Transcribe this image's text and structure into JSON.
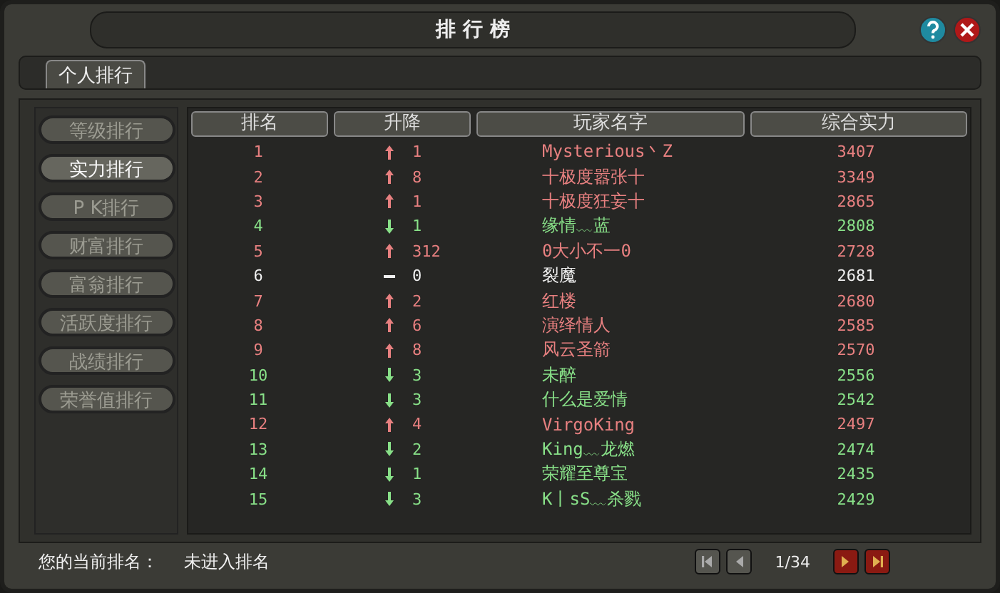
{
  "window": {
    "title": "排 行 榜"
  },
  "tabs": [
    {
      "label": "个人排行",
      "selected": true
    }
  ],
  "sidebar": {
    "items": [
      {
        "label": "等级排行",
        "selected": false
      },
      {
        "label": "实力排行",
        "selected": true
      },
      {
        "label": "P K排行",
        "selected": false
      },
      {
        "label": "财富排行",
        "selected": false
      },
      {
        "label": "富翁排行",
        "selected": false
      },
      {
        "label": "活跃度排行",
        "selected": false
      },
      {
        "label": "战绩排行",
        "selected": false
      },
      {
        "label": "荣誉值排行",
        "selected": false
      }
    ]
  },
  "table": {
    "columns": [
      "排名",
      "升降",
      "玩家名字",
      "综合实力"
    ],
    "rows": [
      {
        "rank": "1",
        "kind": "up",
        "change": "1",
        "name": "Mysterious丶Z",
        "power": "3407"
      },
      {
        "rank": "2",
        "kind": "up",
        "change": "8",
        "name": "十极度嚣张十",
        "power": "3349"
      },
      {
        "rank": "3",
        "kind": "up",
        "change": "1",
        "name": "十极度狂妄十",
        "power": "2865"
      },
      {
        "rank": "4",
        "kind": "down",
        "change": "1",
        "name": "缘情﹏蓝",
        "power": "2808"
      },
      {
        "rank": "5",
        "kind": "up",
        "change": "312",
        "name": "0大小不一0",
        "power": "2728"
      },
      {
        "rank": "6",
        "kind": "same",
        "change": "0",
        "name": "裂魔",
        "power": "2681"
      },
      {
        "rank": "7",
        "kind": "up",
        "change": "2",
        "name": "红楼",
        "power": "2680"
      },
      {
        "rank": "8",
        "kind": "up",
        "change": "6",
        "name": "演绎情人",
        "power": "2585"
      },
      {
        "rank": "9",
        "kind": "up",
        "change": "8",
        "name": "风云圣箭",
        "power": "2570"
      },
      {
        "rank": "10",
        "kind": "down",
        "change": "3",
        "name": "未醉",
        "power": "2556"
      },
      {
        "rank": "11",
        "kind": "down",
        "change": "3",
        "name": "什么是爱情",
        "power": "2542"
      },
      {
        "rank": "12",
        "kind": "up",
        "change": "4",
        "name": "VirgoKing",
        "power": "2497"
      },
      {
        "rank": "13",
        "kind": "down",
        "change": "2",
        "name": "King﹏龙燃",
        "power": "2474"
      },
      {
        "rank": "14",
        "kind": "down",
        "change": "1",
        "name": "荣耀至尊宝",
        "power": "2435"
      },
      {
        "rank": "15",
        "kind": "down",
        "change": "3",
        "name": "K丨sS﹏杀戮",
        "power": "2429"
      }
    ]
  },
  "footer": {
    "label": "您的当前排名：",
    "value": "未进入排名"
  },
  "pager": {
    "page": "1/34",
    "buttons": [
      {
        "kind": "first",
        "disabled": true
      },
      {
        "kind": "prev",
        "disabled": true
      },
      {
        "kind": "next",
        "disabled": false
      },
      {
        "kind": "last",
        "disabled": false
      }
    ]
  }
}
